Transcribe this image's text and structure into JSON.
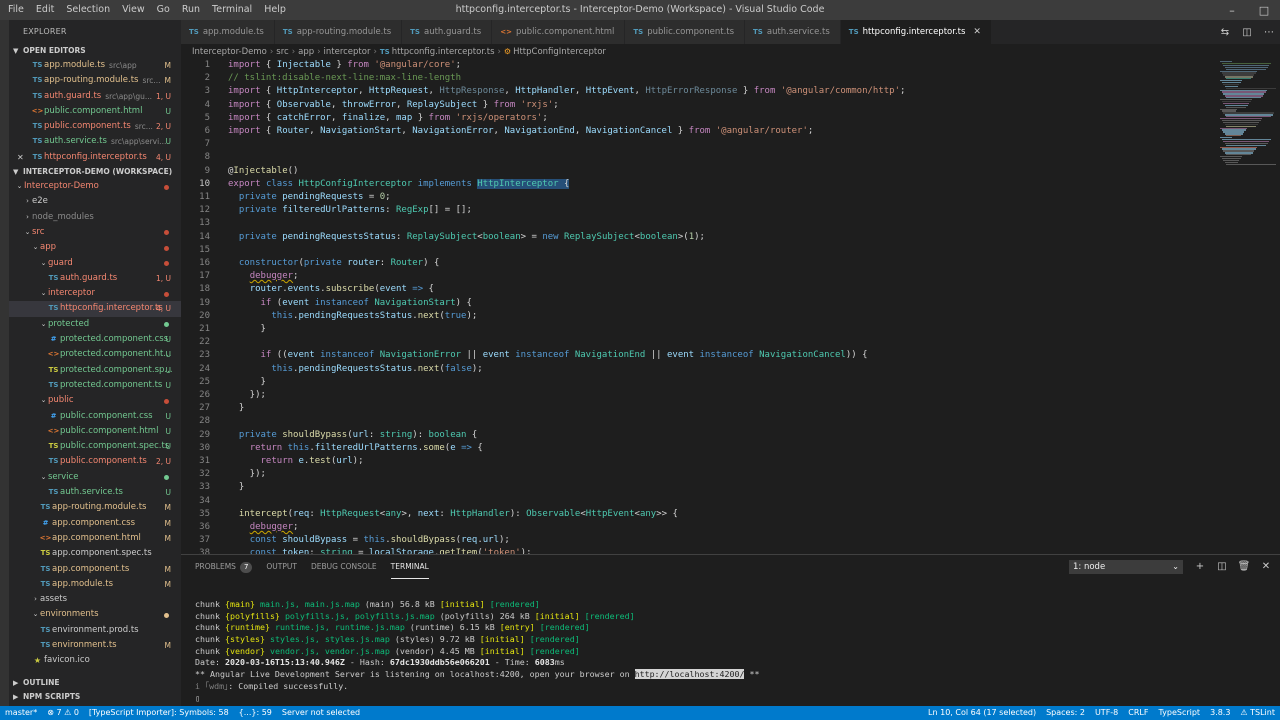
{
  "menu": [
    "File",
    "Edit",
    "Selection",
    "View",
    "Go",
    "Run",
    "Terminal",
    "Help"
  ],
  "window_title": "httpconfig.interceptor.ts - Interceptor-Demo (Workspace) - Visual Studio Code",
  "explorer": {
    "header": "EXPLORER",
    "open_editors_label": "OPEN EDITORS",
    "open_editors": [
      {
        "icon": "TS",
        "name": "app.module.ts",
        "desc": "src\\app",
        "badge": "M",
        "state": "mod"
      },
      {
        "icon": "TS",
        "name": "app-routing.module.ts",
        "desc": "src...",
        "badge": "M",
        "state": "mod"
      },
      {
        "icon": "TS",
        "name": "auth.guard.ts",
        "desc": "src\\app\\gu...",
        "badge": "1, U",
        "state": "err"
      },
      {
        "icon": "HTML",
        "name": "public.component.html",
        "desc": "",
        "badge": "U",
        "state": "unt"
      },
      {
        "icon": "TS",
        "name": "public.component.ts",
        "desc": "src...",
        "badge": "2, U",
        "state": "err"
      },
      {
        "icon": "TS",
        "name": "auth.service.ts",
        "desc": "src\\app\\servi...",
        "badge": "U",
        "state": "unt"
      },
      {
        "icon": "TS",
        "name": "httpconfig.interceptor.ts",
        "desc": "",
        "badge": "4, U",
        "state": "err"
      }
    ],
    "workspace_label": "INTERCEPTOR-DEMO (WORKSPACE)",
    "tree": [
      {
        "level": 0,
        "tw": "v",
        "name": "Interceptor-Demo",
        "state": "err",
        "dot": true
      },
      {
        "level": 1,
        "tw": ">",
        "name": "e2e",
        "state": "plain"
      },
      {
        "level": 1,
        "tw": ">",
        "name": "node_modules",
        "state": "dim"
      },
      {
        "level": 1,
        "tw": "v",
        "name": "src",
        "state": "err",
        "dot": true
      },
      {
        "level": 2,
        "tw": "v",
        "name": "app",
        "state": "err",
        "dot": true
      },
      {
        "level": 3,
        "tw": "v",
        "name": "guard",
        "state": "err",
        "dot": true
      },
      {
        "level": 4,
        "icon": "TS",
        "name": "auth.guard.ts",
        "badge": "1, U",
        "state": "err"
      },
      {
        "level": 3,
        "tw": "v",
        "name": "interceptor",
        "state": "err",
        "dot": true
      },
      {
        "level": 4,
        "icon": "TS",
        "name": "httpconfig.interceptor.ts",
        "badge": "4, U",
        "state": "err",
        "selected": true
      },
      {
        "level": 3,
        "tw": "v",
        "name": "protected",
        "state": "unt",
        "dotc": "unt"
      },
      {
        "level": 4,
        "icon": "#",
        "iclass": "css",
        "name": "protected.component.css",
        "badge": "U",
        "state": "unt"
      },
      {
        "level": 4,
        "icon": "<>",
        "iclass": "html",
        "name": "protected.component.ht...",
        "badge": "U",
        "state": "unt"
      },
      {
        "level": 4,
        "icon": "TS",
        "iclass": "spec",
        "name": "protected.component.sp...",
        "badge": "U",
        "state": "unt"
      },
      {
        "level": 4,
        "icon": "TS",
        "name": "protected.component.ts",
        "badge": "U",
        "state": "unt"
      },
      {
        "level": 3,
        "tw": "v",
        "name": "public",
        "state": "err",
        "dot": true
      },
      {
        "level": 4,
        "icon": "#",
        "iclass": "css",
        "name": "public.component.css",
        "badge": "U",
        "state": "unt"
      },
      {
        "level": 4,
        "icon": "<>",
        "iclass": "html",
        "name": "public.component.html",
        "badge": "U",
        "state": "unt"
      },
      {
        "level": 4,
        "icon": "TS",
        "iclass": "spec",
        "name": "public.component.spec.ts",
        "badge": "U",
        "state": "unt"
      },
      {
        "level": 4,
        "icon": "TS",
        "name": "public.component.ts",
        "badge": "2, U",
        "state": "err"
      },
      {
        "level": 3,
        "tw": "v",
        "name": "service",
        "state": "unt",
        "dotc": "unt"
      },
      {
        "level": 4,
        "icon": "TS",
        "name": "auth.service.ts",
        "badge": "U",
        "state": "unt"
      },
      {
        "level": 3,
        "icon": "TS",
        "name": "app-routing.module.ts",
        "badge": "M",
        "state": "mod"
      },
      {
        "level": 3,
        "icon": "#",
        "iclass": "css",
        "name": "app.component.css",
        "badge": "M",
        "state": "mod"
      },
      {
        "level": 3,
        "icon": "<>",
        "iclass": "html",
        "name": "app.component.html",
        "badge": "M",
        "state": "mod"
      },
      {
        "level": 3,
        "icon": "TS",
        "iclass": "spec",
        "name": "app.component.spec.ts",
        "badge": "",
        "state": "plain"
      },
      {
        "level": 3,
        "icon": "TS",
        "name": "app.component.ts",
        "badge": "M",
        "state": "mod"
      },
      {
        "level": 3,
        "icon": "TS",
        "name": "app.module.ts",
        "badge": "M",
        "state": "mod"
      },
      {
        "level": 2,
        "tw": ">",
        "name": "assets",
        "state": "plain"
      },
      {
        "level": 2,
        "tw": "v",
        "name": "environments",
        "state": "mod",
        "dotc": "mod"
      },
      {
        "level": 3,
        "icon": "TS",
        "name": "environment.prod.ts",
        "badge": "",
        "state": "plain"
      },
      {
        "level": 3,
        "icon": "TS",
        "name": "environment.ts",
        "badge": "M",
        "state": "mod"
      },
      {
        "level": 2,
        "icon": "★",
        "iclass": "fav",
        "name": "favicon.ico",
        "badge": "",
        "state": "plain"
      }
    ],
    "outline_label": "OUTLINE",
    "npm_label": "NPM SCRIPTS"
  },
  "tabs": [
    {
      "icon": "TS",
      "label": "app.module.ts",
      "active": false
    },
    {
      "icon": "TS",
      "label": "app-routing.module.ts",
      "active": false
    },
    {
      "icon": "TS",
      "label": "auth.guard.ts",
      "active": false
    },
    {
      "icon": "<>",
      "label": "public.component.html",
      "active": false
    },
    {
      "icon": "TS",
      "label": "public.component.ts",
      "active": false
    },
    {
      "icon": "TS",
      "label": "auth.service.ts",
      "active": false
    },
    {
      "icon": "TS",
      "label": "httpconfig.interceptor.ts",
      "active": true
    }
  ],
  "breadcrumb": [
    "Interceptor-Demo",
    "src",
    "app",
    "interceptor",
    "httpconfig.interceptor.ts",
    "HttpConfigInterceptor"
  ],
  "code_lines": [
    {
      "n": 1,
      "html": "<span class='kc'>import</span> { <span class='v'>Injectable</span> } <span class='kc'>from</span> <span class='s'>'@angular/core'</span>;"
    },
    {
      "n": 2,
      "html": "<span class='cm'>// tslint:disable-next-line:max-line-length</span>"
    },
    {
      "n": 3,
      "html": "<span class='kc'>import</span> { <span class='v'>HttpInterceptor</span>, <span class='v'>HttpRequest</span>, <span class='dimt'>HttpResponse</span>, <span class='v'>HttpHandler</span>, <span class='v'>HttpEvent</span>, <span class='dimt'>HttpErrorResponse</span> } <span class='kc'>from</span> <span class='s'>'@angular/common/http'</span>;"
    },
    {
      "n": 4,
      "html": "<span class='kc'>import</span> { <span class='v'>Observable</span>, <span class='v'>throwError</span>, <span class='v'>ReplaySubject</span> } <span class='kc'>from</span> <span class='s'>'rxjs'</span>;"
    },
    {
      "n": 5,
      "html": "<span class='kc'>import</span> { <span class='v'>catchError</span>, <span class='v'>finalize</span>, <span class='v'>map</span> } <span class='kc'>from</span> <span class='s'>'rxjs/operators'</span>;"
    },
    {
      "n": 6,
      "html": "<span class='kc'>import</span> { <span class='v'>Router</span>, <span class='v'>NavigationStart</span>, <span class='v'>NavigationError</span>, <span class='v'>NavigationEnd</span>, <span class='v'>NavigationCancel</span> } <span class='kc'>from</span> <span class='s'>'@angular/router'</span>;"
    },
    {
      "n": 7,
      "html": ""
    },
    {
      "n": 8,
      "html": ""
    },
    {
      "n": 9,
      "html": "@<span class='f'>Injectable</span>()"
    },
    {
      "n": 10,
      "html": "<span class='kc'>export</span> <span class='k'>class</span> <span class='t'>HttpConfigInterceptor</span> <span class='k'>implements</span> <span class='hl'><span class='t'>HttpInterceptor</span> {</span>",
      "cur": true
    },
    {
      "n": 11,
      "html": "  <span class='k'>private</span> <span class='v'>pendingRequests</span> = <span class='n'>0</span>;"
    },
    {
      "n": 12,
      "html": "  <span class='k'>private</span> <span class='v'>filteredUrlPatterns</span>: <span class='t'>RegExp</span>[] = [];"
    },
    {
      "n": 13,
      "html": ""
    },
    {
      "n": 14,
      "html": "  <span class='k'>private</span> <span class='v'>pendingRequestsStatus</span>: <span class='t'>ReplaySubject</span>&lt;<span class='t'>boolean</span>&gt; = <span class='k'>new</span> <span class='t'>ReplaySubject</span>&lt;<span class='t'>boolean</span>&gt;(<span class='n'>1</span>);"
    },
    {
      "n": 15,
      "html": ""
    },
    {
      "n": 16,
      "html": "  <span class='k'>constructor</span>(<span class='k'>private</span> <span class='v'>router</span>: <span class='t'>Router</span>) {"
    },
    {
      "n": 17,
      "html": "    <span class='kc squig'>debugger</span>;"
    },
    {
      "n": 18,
      "html": "    <span class='v'>router</span>.<span class='v'>events</span>.<span class='f'>subscribe</span>(<span class='v'>event</span> <span class='k'>=&gt;</span> {"
    },
    {
      "n": 19,
      "html": "      <span class='kc'>if</span> (<span class='v'>event</span> <span class='k'>instanceof</span> <span class='t'>NavigationStart</span>) {"
    },
    {
      "n": 20,
      "html": "        <span class='k'>this</span>.<span class='v'>pendingRequestsStatus</span>.<span class='f'>next</span>(<span class='k'>true</span>);"
    },
    {
      "n": 21,
      "html": "      }"
    },
    {
      "n": 22,
      "html": ""
    },
    {
      "n": 23,
      "html": "      <span class='kc'>if</span> ((<span class='v'>event</span> <span class='k'>instanceof</span> <span class='t'>NavigationError</span> || <span class='v'>event</span> <span class='k'>instanceof</span> <span class='t'>NavigationEnd</span> || <span class='v'>event</span> <span class='k'>instanceof</span> <span class='t'>NavigationCancel</span>)) {"
    },
    {
      "n": 24,
      "html": "        <span class='k'>this</span>.<span class='v'>pendingRequestsStatus</span>.<span class='f'>next</span>(<span class='k'>false</span>);"
    },
    {
      "n": 25,
      "html": "      }"
    },
    {
      "n": 26,
      "html": "    });"
    },
    {
      "n": 27,
      "html": "  }"
    },
    {
      "n": 28,
      "html": ""
    },
    {
      "n": 29,
      "html": "  <span class='k'>private</span> <span class='f'>shouldBypass</span>(<span class='v'>url</span>: <span class='t'>string</span>): <span class='t'>boolean</span> {"
    },
    {
      "n": 30,
      "html": "    <span class='kc'>return</span> <span class='k'>this</span>.<span class='v'>filteredUrlPatterns</span>.<span class='f'>some</span>(<span class='v'>e</span> <span class='k'>=&gt;</span> {"
    },
    {
      "n": 31,
      "html": "      <span class='kc'>return</span> <span class='v'>e</span>.<span class='f'>test</span>(<span class='v'>url</span>);"
    },
    {
      "n": 32,
      "html": "    });"
    },
    {
      "n": 33,
      "html": "  }"
    },
    {
      "n": 34,
      "html": ""
    },
    {
      "n": 35,
      "html": "  <span class='f'>intercept</span>(<span class='v'>req</span>: <span class='t'>HttpRequest</span>&lt;<span class='t'>any</span>&gt;, <span class='v'>next</span>: <span class='t'>HttpHandler</span>): <span class='t'>Observable</span>&lt;<span class='t'>HttpEvent</span>&lt;<span class='t'>any</span>&gt;&gt; {"
    },
    {
      "n": 36,
      "html": "    <span class='kc squig'>debugger</span>;"
    },
    {
      "n": 37,
      "html": "    <span class='k'>const</span> <span class='v'>shouldBypass</span> = <span class='k'>this</span>.<span class='f'>shouldBypass</span>(<span class='v'>req</span>.<span class='v'>url</span>);"
    },
    {
      "n": 38,
      "html": "    <span class='k'>const</span> <span class='v'>token</span>: <span class='t'>string</span> = <span class='v'>localStorage</span>.<span class='f'>getItem</span>(<span class='s'>'token'</span>);"
    }
  ],
  "panel": {
    "tabs": [
      {
        "label": "PROBLEMS",
        "badge": "7",
        "active": false
      },
      {
        "label": "OUTPUT",
        "active": false
      },
      {
        "label": "DEBUG CONSOLE",
        "active": false
      },
      {
        "label": "TERMINAL",
        "active": true
      }
    ],
    "terminal_select": "1: node"
  },
  "terminal_lines": [
    "chunk <span class='ty'>{main}</span> <span class='tg'>main.js, main.js.map</span> (main) 56.8 kB <span class='ty'>[initial]</span> <span class='tg'>[rendered]</span>",
    "chunk <span class='ty'>{polyfills}</span> <span class='tg'>polyfills.js, polyfills.js.map</span> (polyfills) 264 kB <span class='ty'>[initial]</span> <span class='tg'>[rendered]</span>",
    "chunk <span class='ty'>{runtime}</span> <span class='tg'>runtime.js, runtime.js.map</span> (runtime) 6.15 kB <span class='ty'>[entry]</span> <span class='tg'>[rendered]</span>",
    "chunk <span class='ty'>{styles}</span> <span class='tg'>styles.js, styles.js.map</span> (styles) 9.72 kB <span class='ty'>[initial]</span> <span class='tg'>[rendered]</span>",
    "chunk <span class='ty'>{vendor}</span> <span class='tg'>vendor.js, vendor.js.map</span> (vendor) 4.45 MB <span class='ty'>[initial]</span> <span class='tg'>[rendered]</span>",
    "Date: <span class='tw2'>2020-03-16T15:13:40.946Z</span> - Hash: <span class='tw2'>67dc1930ddb56e066201</span> - Time: <span class='tw2'>6083</span>ms",
    "** Angular Live Development Server is listening on localhost:4200, open your browser on <span class='tlink'>http://localhost:4200/</span> **",
    "<span class='tdim'>i</span> <span class='tdim'>｢wdm｣</span>: Compiled successfully.",
    "▯"
  ],
  "status": {
    "branch": "master*",
    "problems": "⊗ 7 ⚠ 0",
    "ts_importer": "[TypeScript Importer]: Symbols: 58",
    "symbols": "{...}: 59",
    "server": "Server not selected",
    "position": "Ln 10, Col 64 (17 selected)",
    "spaces": "Spaces: 2",
    "encoding": "UTF-8",
    "eol": "CRLF",
    "language": "TypeScript",
    "version": "3.8.3",
    "tslint": "⚠ TSLint"
  }
}
